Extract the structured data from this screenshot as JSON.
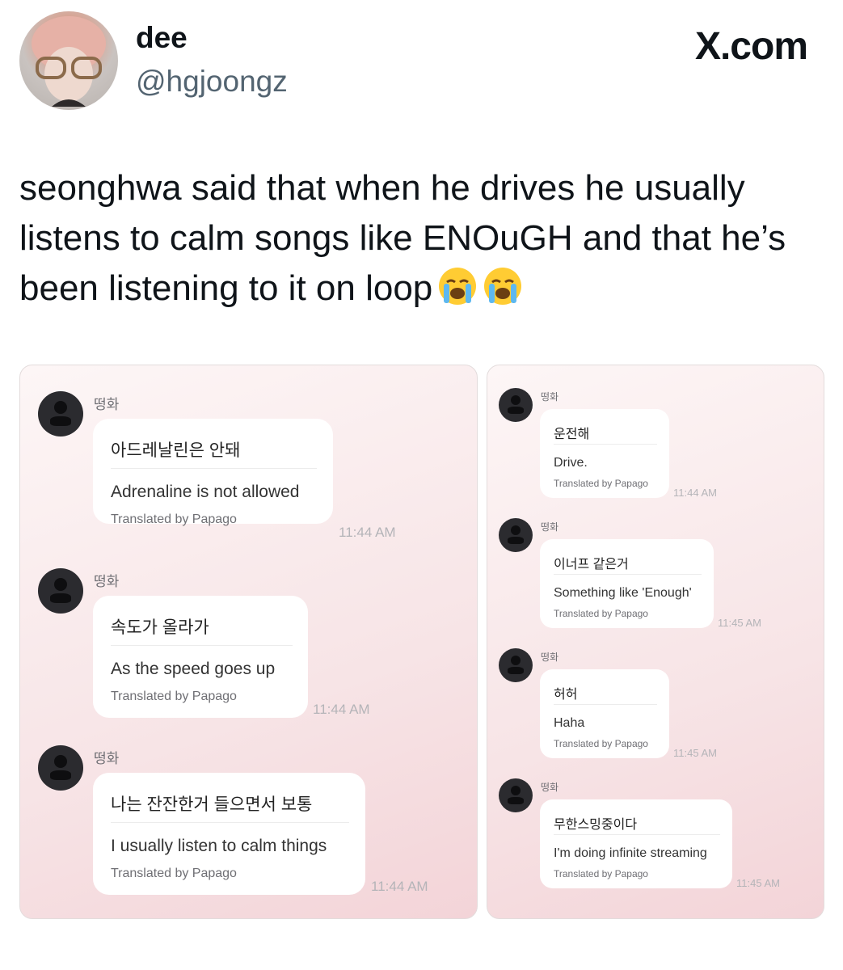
{
  "tweet": {
    "display_name": "dee",
    "handle": "@hgjoongz",
    "site_logo": "X.com",
    "text": "seonghwa said that when he drives he usually listens to calm songs like ENOuGH and that he’s been listening to it on loop",
    "emojis": [
      "loudly-crying-face-icon",
      "loudly-crying-face-icon"
    ]
  },
  "left_chat": {
    "messages": [
      {
        "sender": "떵화",
        "korean": "아드레날린은 안돼",
        "english": "Adrenaline is not allowed",
        "translated_by": "Translated by Papago",
        "time": "11:44 AM"
      },
      {
        "sender": "떵화",
        "korean": "속도가 올라가",
        "english": "As the speed goes up",
        "translated_by": "Translated by Papago",
        "time": "11:44 AM"
      },
      {
        "sender": "떵화",
        "korean": "나는 잔잔한거 들으면서 보통",
        "english": "I usually listen to calm things",
        "translated_by": "Translated by Papago",
        "time": "11:44 AM"
      }
    ]
  },
  "right_chat": {
    "messages": [
      {
        "sender": "떵화",
        "korean": "운전해",
        "english": "Drive.",
        "translated_by": "Translated by Papago",
        "time": "11:44 AM"
      },
      {
        "sender": "떵화",
        "korean": "이너프 같은거",
        "english": "Something like 'Enough'",
        "translated_by": "Translated by Papago",
        "time": "11:45 AM"
      },
      {
        "sender": "떵화",
        "korean": "허허",
        "english": "Haha",
        "translated_by": "Translated by Papago",
        "time": "11:45 AM"
      },
      {
        "sender": "떵화",
        "korean": "무한스밍중이다",
        "english": "I'm doing infinite streaming",
        "translated_by": "Translated by Papago",
        "time": "11:45 AM"
      }
    ]
  },
  "colors": {
    "panel_background_top": "#fdf6f6",
    "panel_background_bottom": "#f3d4d8",
    "bubble": "#ffffff",
    "handle_gray": "#536471"
  }
}
